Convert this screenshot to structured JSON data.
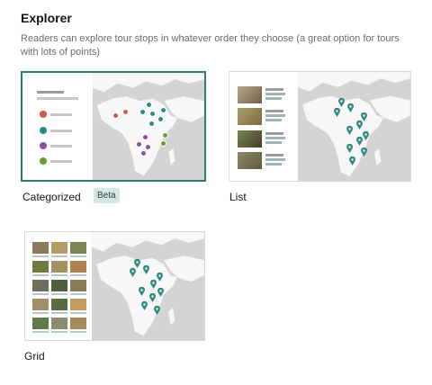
{
  "section": {
    "title": "Explorer",
    "description": "Readers can explore tour stops in whatever order they choose (a great option for tours with lots of points)"
  },
  "options": [
    {
      "label": "Categorized",
      "badge": "Beta",
      "selected": true
    },
    {
      "label": "List",
      "selected": false
    },
    {
      "label": "Grid",
      "selected": false
    }
  ],
  "colors": {
    "accent": "#2f7b73",
    "pin_teal": "#2f8a84",
    "category_red": "#cf5a52",
    "category_teal": "#2f8a84",
    "category_purple": "#8a4fa8",
    "category_green": "#6e9a3a"
  }
}
